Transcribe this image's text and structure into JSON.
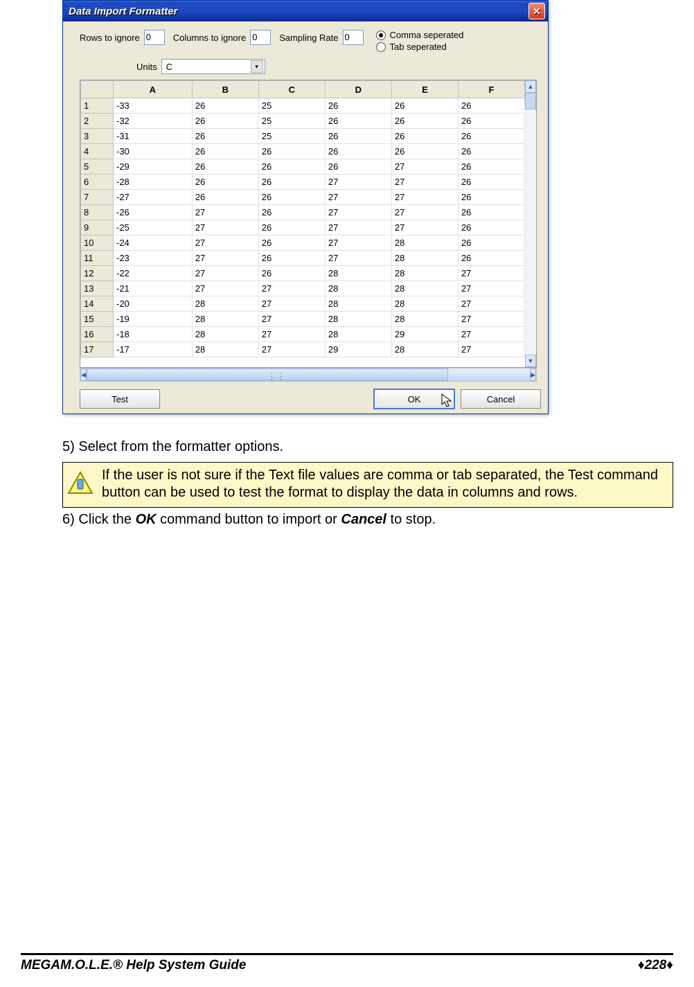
{
  "dialog": {
    "title": "Data Import Formatter",
    "labels": {
      "rows": "Rows to ignore",
      "cols": "Columns to ignore",
      "rate": "Sampling Rate",
      "units": "Units"
    },
    "values": {
      "rows": "0",
      "cols": "0",
      "rate": "0",
      "units": "C"
    },
    "radios": {
      "comma": "Comma seperated",
      "tab": "Tab seperated",
      "selected": "comma"
    },
    "columns": [
      "A",
      "B",
      "C",
      "D",
      "E",
      "F"
    ],
    "rows": [
      {
        "n": "1",
        "cells": [
          "-33",
          "26",
          "25",
          "26",
          "26",
          "26"
        ]
      },
      {
        "n": "2",
        "cells": [
          "-32",
          "26",
          "25",
          "26",
          "26",
          "26"
        ]
      },
      {
        "n": "3",
        "cells": [
          "-31",
          "26",
          "25",
          "26",
          "26",
          "26"
        ]
      },
      {
        "n": "4",
        "cells": [
          "-30",
          "26",
          "26",
          "26",
          "26",
          "26"
        ]
      },
      {
        "n": "5",
        "cells": [
          "-29",
          "26",
          "26",
          "26",
          "27",
          "26"
        ]
      },
      {
        "n": "6",
        "cells": [
          "-28",
          "26",
          "26",
          "27",
          "27",
          "26"
        ]
      },
      {
        "n": "7",
        "cells": [
          "-27",
          "26",
          "26",
          "27",
          "27",
          "26"
        ]
      },
      {
        "n": "8",
        "cells": [
          "-26",
          "27",
          "26",
          "27",
          "27",
          "26"
        ]
      },
      {
        "n": "9",
        "cells": [
          "-25",
          "27",
          "26",
          "27",
          "27",
          "26"
        ]
      },
      {
        "n": "10",
        "cells": [
          "-24",
          "27",
          "26",
          "27",
          "28",
          "26"
        ]
      },
      {
        "n": "11",
        "cells": [
          "-23",
          "27",
          "26",
          "27",
          "28",
          "26"
        ]
      },
      {
        "n": "12",
        "cells": [
          "-22",
          "27",
          "26",
          "28",
          "28",
          "27"
        ]
      },
      {
        "n": "13",
        "cells": [
          "-21",
          "27",
          "27",
          "28",
          "28",
          "27"
        ]
      },
      {
        "n": "14",
        "cells": [
          "-20",
          "28",
          "27",
          "28",
          "28",
          "27"
        ]
      },
      {
        "n": "15",
        "cells": [
          "-19",
          "28",
          "27",
          "28",
          "28",
          "27"
        ]
      },
      {
        "n": "16",
        "cells": [
          "-18",
          "28",
          "27",
          "28",
          "29",
          "27"
        ]
      },
      {
        "n": "17",
        "cells": [
          "-17",
          "28",
          "27",
          "29",
          "28",
          "27"
        ]
      }
    ],
    "buttons": {
      "test": "Test",
      "ok": "OK",
      "cancel": "Cancel"
    }
  },
  "steps": {
    "s5": "5)  Select from the formatter options.",
    "tip": "If the user is not sure if the Text file values are comma or tab separated, the Test command button can be used to test the format to display the data in columns and rows.",
    "s6_pre": "6)  Click the ",
    "s6_ok": "OK",
    "s6_mid": " command button to import or ",
    "s6_cancel": "Cancel",
    "s6_post": " to stop."
  },
  "footer": {
    "guide_pre": "MEGA",
    "guide_post": "M.O.L.E.® Help System Guide",
    "page": "228",
    "diamond": "♦"
  }
}
